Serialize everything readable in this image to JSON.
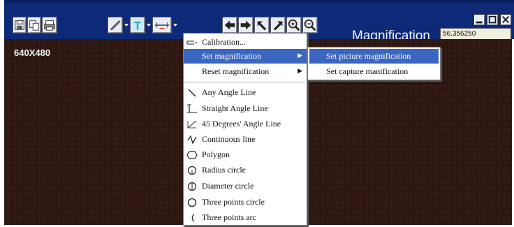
{
  "toolbar": {
    "file_buttons": [
      {
        "icon": "save-icon"
      },
      {
        "icon": "copy-icon"
      },
      {
        "icon": "print-icon"
      }
    ],
    "tool_buttons": [
      {
        "icon": "draw-line-icon"
      },
      {
        "icon": "text-tool-icon",
        "glyph": "T"
      },
      {
        "icon": "ruler-icon"
      }
    ],
    "nav_buttons": [
      {
        "icon": "arrow-left-icon"
      },
      {
        "icon": "arrow-right-icon"
      },
      {
        "icon": "undo-icon"
      },
      {
        "icon": "redo-icon"
      },
      {
        "icon": "zoom-in-icon"
      },
      {
        "icon": "zoom-out-icon"
      }
    ],
    "window_buttons": [
      {
        "icon": "minimize-icon"
      },
      {
        "icon": "maximize-icon"
      },
      {
        "icon": "close-icon"
      }
    ],
    "magnification_label": "Magnification",
    "magnification_value": "56.356250"
  },
  "canvas": {
    "resolution": "640X480"
  },
  "context_menu": {
    "items": [
      {
        "label": "Calibration...",
        "icon": "calibration-icon"
      },
      {
        "label": "Set magnification",
        "has_submenu": true,
        "highlighted": true
      },
      {
        "label": "Reset magnification",
        "has_submenu": true
      },
      {
        "label": "Any Angle Line",
        "icon": "any-angle-line-icon"
      },
      {
        "label": "Straight Angle Line",
        "icon": "straight-angle-line-icon"
      },
      {
        "label": "45 Degrees' Angle Line",
        "icon": "45-degree-line-icon"
      },
      {
        "label": "Continuous line",
        "icon": "continuous-line-icon"
      },
      {
        "label": "Polygon",
        "icon": "polygon-icon"
      },
      {
        "label": "Radius circle",
        "icon": "radius-circle-icon"
      },
      {
        "label": "Diameter circle",
        "icon": "diameter-circle-icon"
      },
      {
        "label": "Three points circle",
        "icon": "three-points-circle-icon"
      },
      {
        "label": "Three points arc",
        "icon": "three-points-arc-icon"
      }
    ],
    "submenu_arrow": "▶"
  },
  "submenu": {
    "items": [
      {
        "label": "Set picture magnification",
        "highlighted": true
      },
      {
        "label": "Set capture manification"
      }
    ]
  },
  "colors": {
    "toolbar_bg": "#0d2a78",
    "highlight": "#3b66c2",
    "canvas_bg": "#2b1712",
    "text_tool_accent": "#2aa8c8"
  }
}
